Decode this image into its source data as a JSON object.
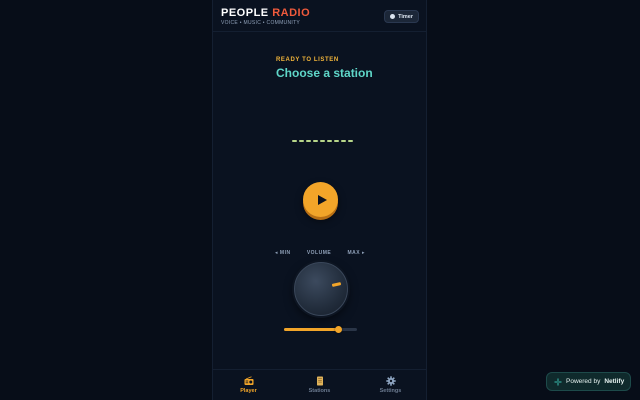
{
  "app": {
    "title_primary": "PEOPLE",
    "title_accent": "RADIO",
    "tagline": "VOICE • MUSIC • COMMUNITY",
    "timer_label": "Timer"
  },
  "player": {
    "status": "READY TO LISTEN",
    "station": "Choose a station",
    "play_icon": "play-icon"
  },
  "volume": {
    "min_label": "◂ MIN",
    "label": "VOLUME",
    "max_label": "MAX ▸",
    "level_percent": 74
  },
  "nav": {
    "items": [
      {
        "label": "Player",
        "icon": "radio-icon",
        "active": true
      },
      {
        "label": "Stations",
        "icon": "list-icon",
        "active": false
      },
      {
        "label": "Settings",
        "icon": "gear-icon",
        "active": false
      }
    ]
  },
  "badge": {
    "prefix": "Powered by",
    "brand": "Netlify"
  },
  "colors": {
    "accent": "#f2a529",
    "brand_red": "#f05a3c",
    "station_teal": "#5fd6c8",
    "background": "#070d18"
  }
}
